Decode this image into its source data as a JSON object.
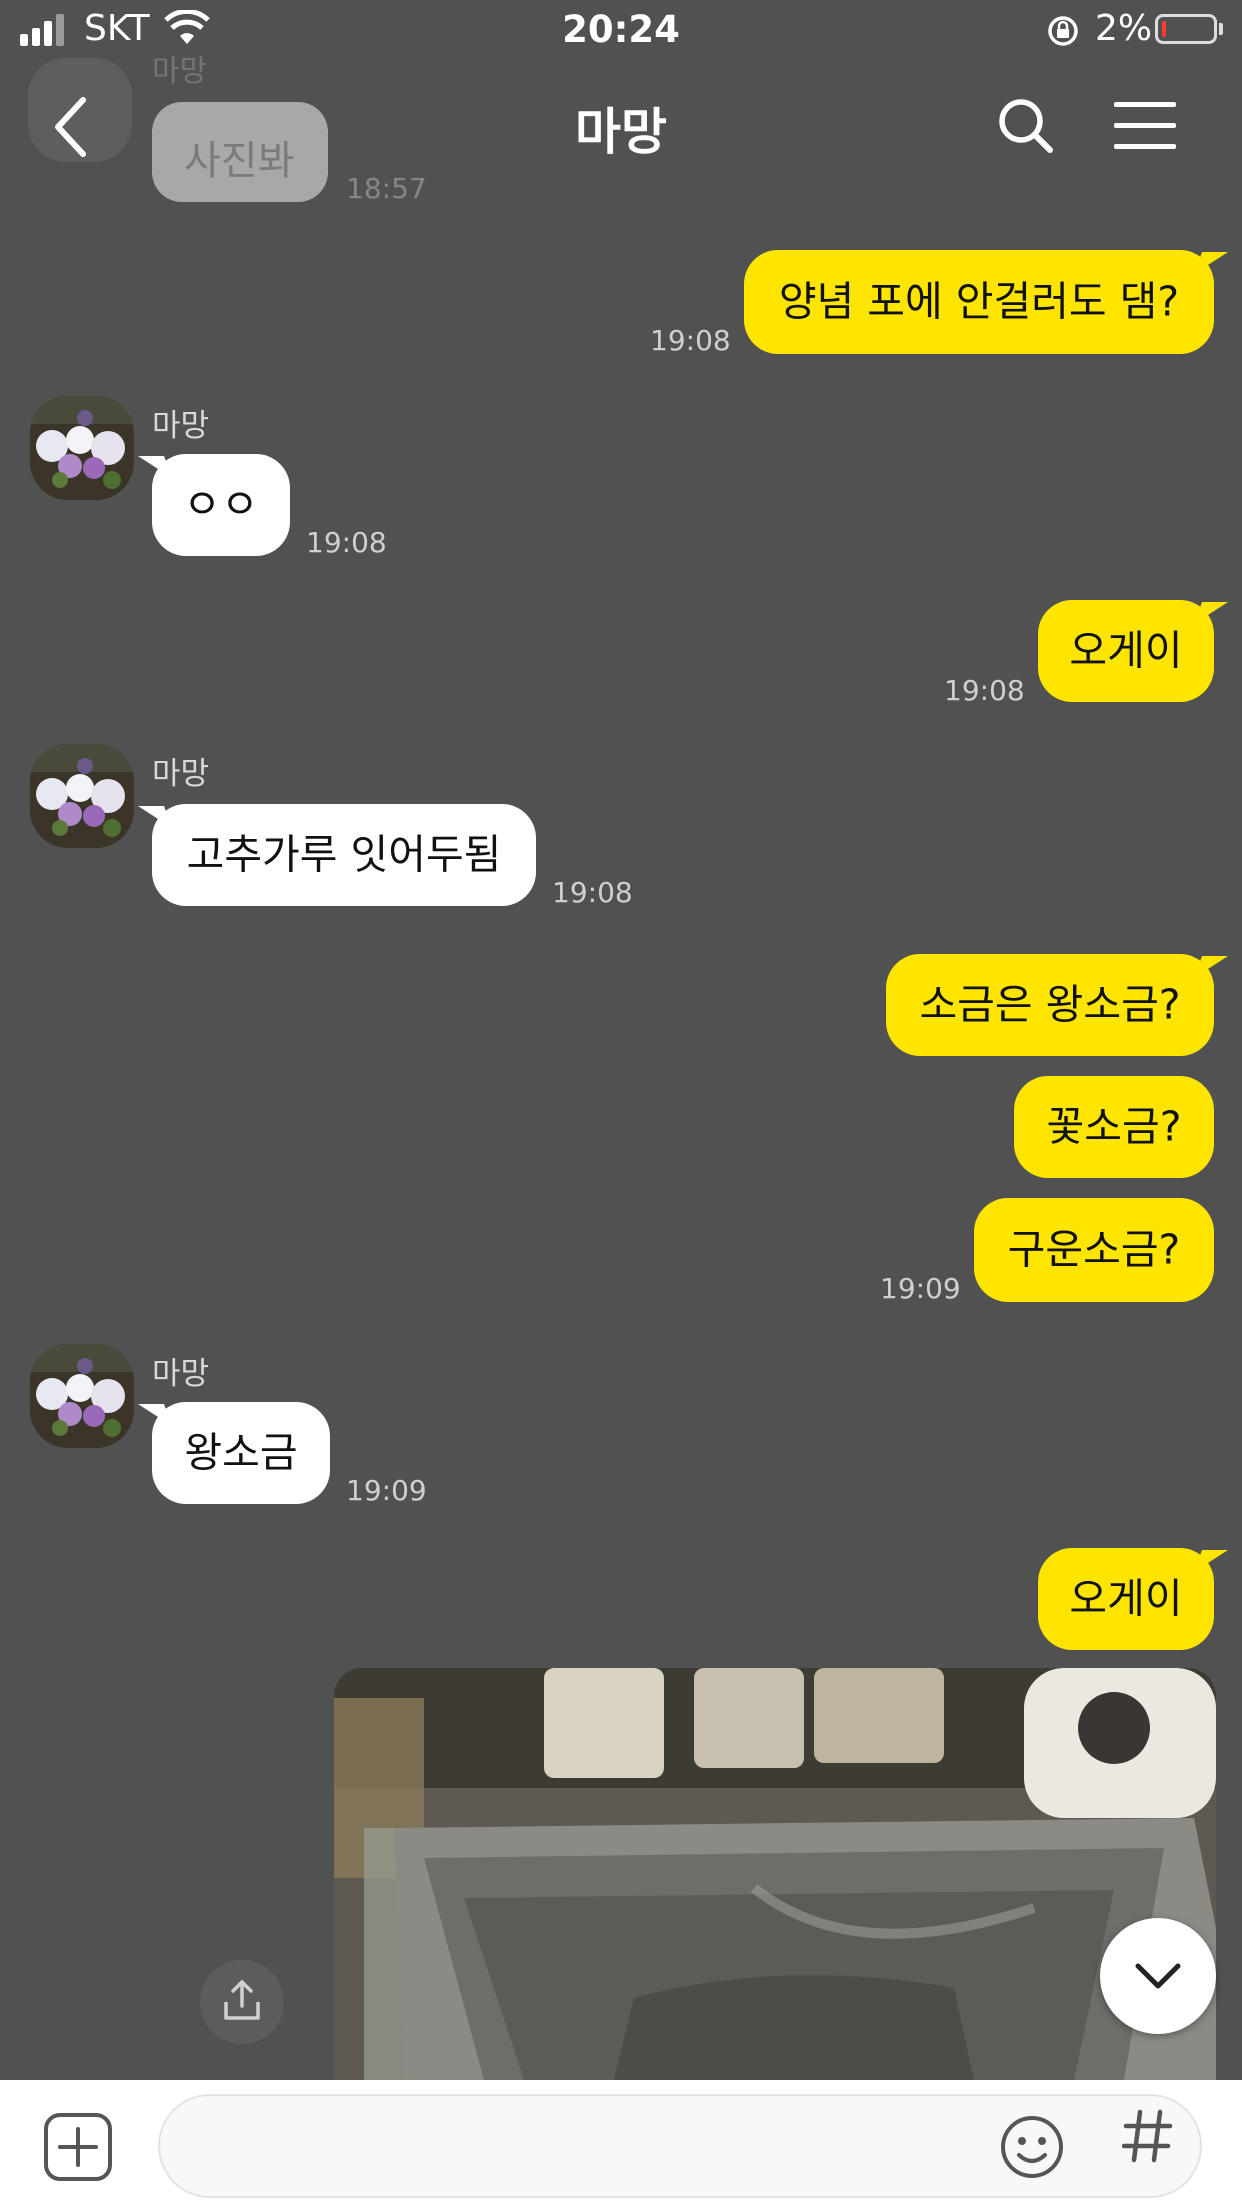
{
  "status_bar": {
    "carrier": "SKT",
    "time": "20:24",
    "battery_percent": "2%",
    "icons": [
      "signal-icon",
      "wifi-icon",
      "rotation-lock-icon",
      "battery-low-icon"
    ]
  },
  "header": {
    "title": "마망",
    "icons": [
      "back-arrow-icon",
      "search-icon",
      "menu-icon"
    ]
  },
  "partial_message": {
    "name": "마망",
    "text": "사진봐",
    "time": "18:57"
  },
  "messages": [
    {
      "from": "me",
      "text": "양념 포에 안걸러도 댐?",
      "time": "19:08"
    },
    {
      "from": "other",
      "name": "마망",
      "text": "ㅇㅇ",
      "time": "19:08"
    },
    {
      "from": "me",
      "text": "오게이",
      "time": "19:08"
    },
    {
      "from": "other",
      "name": "마망",
      "text": "고추가루 잇어두됨",
      "time": "19:08"
    },
    {
      "from": "me",
      "text": "소금은 왕소금?"
    },
    {
      "from": "me",
      "text": "꽃소금?"
    },
    {
      "from": "me",
      "text": "구운소금?",
      "time": "19:09"
    },
    {
      "from": "other",
      "name": "마망",
      "text": "왕소금",
      "time": "19:09"
    },
    {
      "from": "me",
      "text": "오게이"
    },
    {
      "from": "me",
      "type": "photo",
      "icon": "photo-metal-container"
    }
  ],
  "floating": {
    "share_icon": "share-icon",
    "scroll_down_icon": "chevron-down-icon"
  },
  "input_bar": {
    "placeholder": "",
    "icons": [
      "add-icon",
      "emoji-icon",
      "hash-icon"
    ]
  },
  "colors": {
    "background": "#515151",
    "my_bubble": "#fee500",
    "other_bubble": "#ffffff",
    "input_bar": "#ffffff"
  }
}
